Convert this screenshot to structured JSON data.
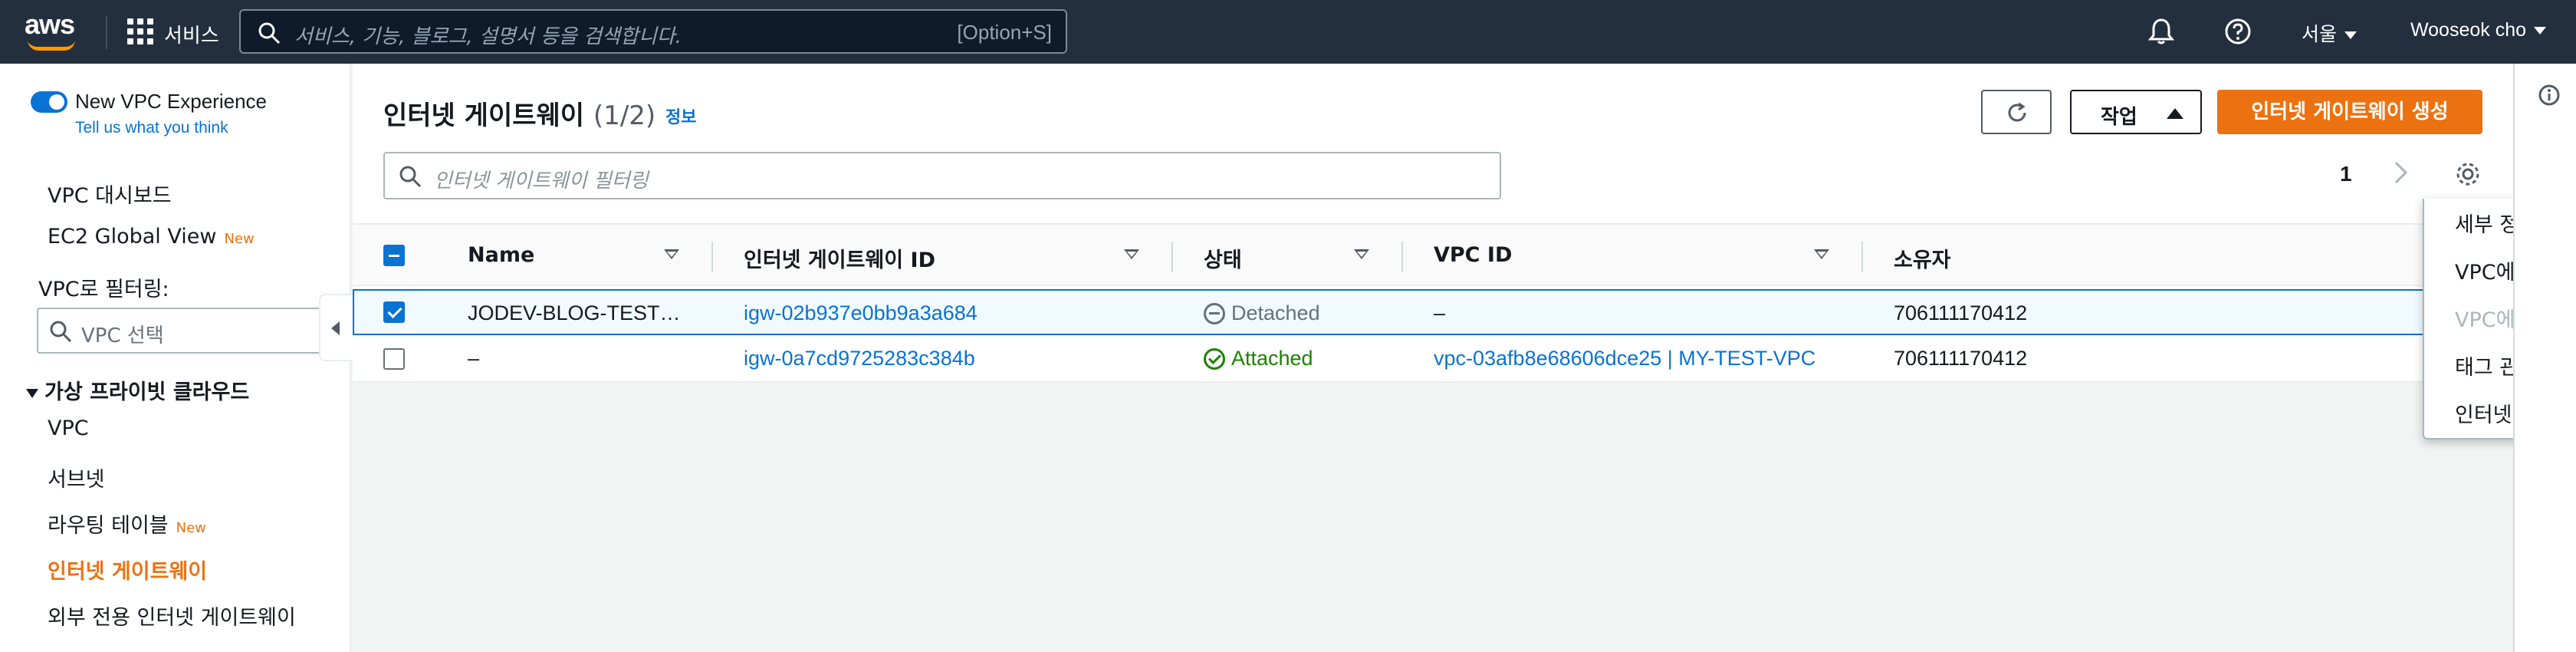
{
  "topnav": {
    "logo_text": "aws",
    "services_label": "서비스",
    "search_placeholder": "서비스, 기능, 블로그, 설명서 등을 검색합니다.",
    "search_shortcut": "[Option+S]",
    "region": "서울",
    "user": "Wooseok cho",
    "icons": [
      "bell-icon",
      "help-icon"
    ]
  },
  "sidebar": {
    "toggle_label": "New VPC Experience",
    "tell_us": "Tell us what you think",
    "items_top": [
      {
        "label": "VPC 대시보드",
        "badge": ""
      },
      {
        "label": "EC2 Global View",
        "badge": "New"
      }
    ],
    "filter_label": "VPC로 필터링:",
    "filter_placeholder": "VPC 선택",
    "section": "가상 프라이빗 클라우드",
    "items": [
      {
        "label": "VPC",
        "badge": ""
      },
      {
        "label": "서브넷",
        "badge": ""
      },
      {
        "label": "라우팅 테이블",
        "badge": "New"
      },
      {
        "label": "인터넷 게이트웨이",
        "badge": ""
      },
      {
        "label": "외부 전용 인터넷 게이트웨이",
        "badge": ""
      }
    ]
  },
  "main": {
    "title": "인터넷 게이트웨이",
    "count": "(1/2)",
    "info": "정보",
    "actions_label": "작업",
    "create_label": "인터넷 게이트웨이 생성",
    "filter_placeholder": "인터넷 게이트웨이 필터링",
    "page": "1"
  },
  "table": {
    "columns": [
      "Name",
      "인터넷 게이트웨이 ID",
      "상태",
      "VPC ID",
      "소유자"
    ],
    "rows": [
      {
        "name": "JODEV-BLOG-TEST…",
        "id": "igw-02b937e0bb9a3a684",
        "state": "Detached",
        "vpc": "–",
        "owner": "706111170412",
        "selected": true
      },
      {
        "name": "–",
        "id": "igw-0a7cd9725283c384b",
        "state": "Attached",
        "vpc": "vpc-03afb8e68606dce25 | MY-TEST-VPC",
        "owner": "706111170412",
        "selected": false
      }
    ]
  },
  "actions_menu": {
    "items": [
      {
        "label": "세부 정보 보기",
        "disabled": false
      },
      {
        "label": "VPC에 연결",
        "disabled": false
      },
      {
        "label": "VPC에서 분리",
        "disabled": true
      },
      {
        "label": "태그 관리",
        "disabled": false
      },
      {
        "label": "인터넷 게이트웨이 삭제",
        "disabled": false
      }
    ]
  },
  "colors": {
    "nav_bg": "#232f3e",
    "accent_orange": "#ec7211",
    "link_blue": "#0972d3",
    "attached_green": "#1d8102"
  }
}
